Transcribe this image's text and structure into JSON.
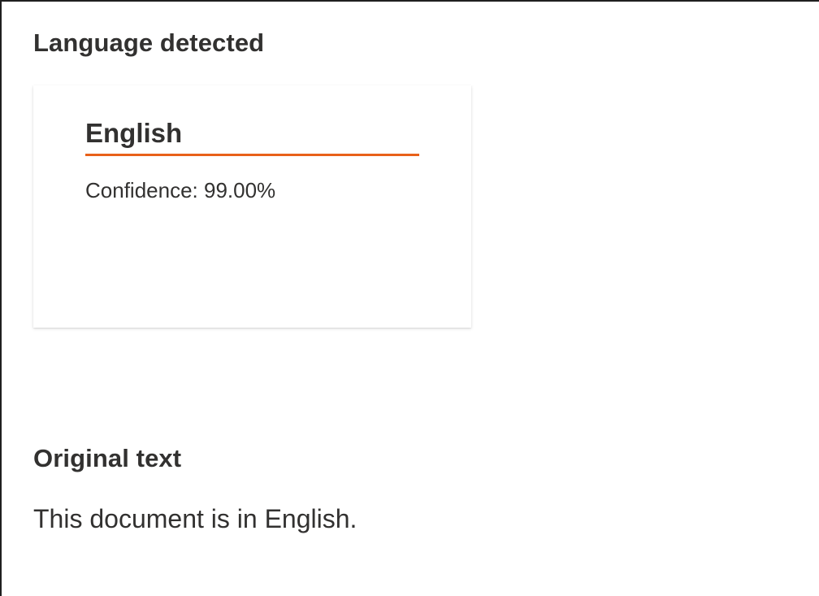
{
  "sections": {
    "language_detected_title": "Language detected",
    "original_text_title": "Original text"
  },
  "result": {
    "language": "English",
    "confidence_label": "Confidence: 99.00%",
    "accent_color": "#e8611a"
  },
  "original": {
    "text": "This document is in English."
  }
}
